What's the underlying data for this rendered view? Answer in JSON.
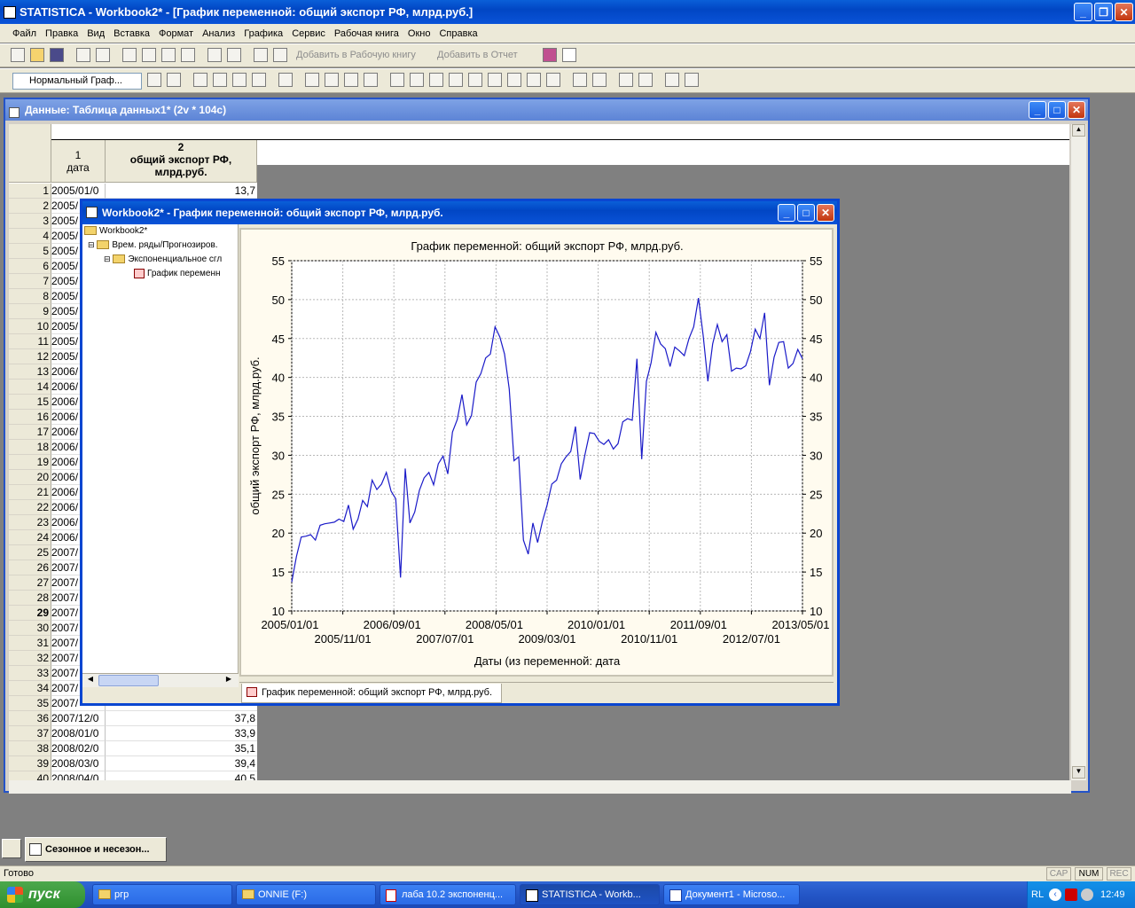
{
  "app": {
    "title": "STATISTICA - Workbook2* - [График переменной: общий экспорт РФ, млрд.руб.]",
    "menu": [
      "Файл",
      "Правка",
      "Вид",
      "Вставка",
      "Формат",
      "Анализ",
      "Графика",
      "Сервис",
      "Рабочая книга",
      "Окно",
      "Справка"
    ]
  },
  "toolbar1": {
    "add_to_workbook": "Добавить в Рабочую книгу",
    "add_to_report": "Добавить в Отчет"
  },
  "toolbar2": {
    "style_select": "Нормальный Граф..."
  },
  "data_window": {
    "title": "Данные: Таблица данных1* (2v * 104c)",
    "col1_num": "1",
    "col1_name": "дата",
    "col2_num": "2",
    "col2_name": "общий экспорт РФ, млрд.руб.",
    "rows": [
      {
        "n": "1",
        "date": "2005/01/0",
        "value": "13,7"
      },
      {
        "n": "2",
        "date": "2005/",
        "value": ""
      },
      {
        "n": "3",
        "date": "2005/",
        "value": ""
      },
      {
        "n": "4",
        "date": "2005/",
        "value": ""
      },
      {
        "n": "5",
        "date": "2005/",
        "value": ""
      },
      {
        "n": "6",
        "date": "2005/",
        "value": ""
      },
      {
        "n": "7",
        "date": "2005/",
        "value": ""
      },
      {
        "n": "8",
        "date": "2005/",
        "value": ""
      },
      {
        "n": "9",
        "date": "2005/",
        "value": ""
      },
      {
        "n": "10",
        "date": "2005/",
        "value": ""
      },
      {
        "n": "11",
        "date": "2005/",
        "value": ""
      },
      {
        "n": "12",
        "date": "2005/",
        "value": ""
      },
      {
        "n": "13",
        "date": "2006/",
        "value": ""
      },
      {
        "n": "14",
        "date": "2006/",
        "value": ""
      },
      {
        "n": "15",
        "date": "2006/",
        "value": ""
      },
      {
        "n": "16",
        "date": "2006/",
        "value": ""
      },
      {
        "n": "17",
        "date": "2006/",
        "value": ""
      },
      {
        "n": "18",
        "date": "2006/",
        "value": ""
      },
      {
        "n": "19",
        "date": "2006/",
        "value": ""
      },
      {
        "n": "20",
        "date": "2006/",
        "value": ""
      },
      {
        "n": "21",
        "date": "2006/",
        "value": ""
      },
      {
        "n": "22",
        "date": "2006/",
        "value": ""
      },
      {
        "n": "23",
        "date": "2006/",
        "value": ""
      },
      {
        "n": "24",
        "date": "2006/",
        "value": ""
      },
      {
        "n": "25",
        "date": "2007/",
        "value": ""
      },
      {
        "n": "26",
        "date": "2007/",
        "value": ""
      },
      {
        "n": "27",
        "date": "2007/",
        "value": ""
      },
      {
        "n": "28",
        "date": "2007/",
        "value": ""
      },
      {
        "n": "29",
        "date": "2007/",
        "value": ""
      },
      {
        "n": "30",
        "date": "2007/",
        "value": ""
      },
      {
        "n": "31",
        "date": "2007/",
        "value": ""
      },
      {
        "n": "32",
        "date": "2007/",
        "value": ""
      },
      {
        "n": "33",
        "date": "2007/",
        "value": ""
      },
      {
        "n": "34",
        "date": "2007/",
        "value": ""
      },
      {
        "n": "35",
        "date": "2007/",
        "value": ""
      },
      {
        "n": "36",
        "date": "2007/12/0",
        "value": "37,8"
      },
      {
        "n": "37",
        "date": "2008/01/0",
        "value": "33,9"
      },
      {
        "n": "38",
        "date": "2008/02/0",
        "value": "35,1"
      },
      {
        "n": "39",
        "date": "2008/03/0",
        "value": "39,4"
      },
      {
        "n": "40",
        "date": "2008/04/0",
        "value": "40,5"
      }
    ]
  },
  "graph_window": {
    "title": "Workbook2* - График переменной: общий экспорт РФ, млрд.руб.",
    "tree": {
      "root": "Workbook2*",
      "level1": "Врем. ряды/Прогнозиров.",
      "level2": "Экспоненциальное сгл",
      "level3": "График переменн"
    },
    "tab_label": "График переменной: общий экспорт РФ, млрд.руб."
  },
  "chart_data": {
    "type": "line",
    "title": "График переменной: общий экспорт РФ, млрд.руб.",
    "xlabel": "Даты (из переменной: дата",
    "ylabel": "общий экспорт РФ, млрд.руб.",
    "ylim": [
      10,
      55
    ],
    "yticks": [
      10,
      15,
      20,
      25,
      30,
      35,
      40,
      45,
      50,
      55
    ],
    "xticks_row1": [
      "2005/01/01",
      "2006/09/01",
      "2008/05/01",
      "2010/01/01",
      "2011/09/01",
      "2013/05/01"
    ],
    "xticks_row2": [
      "2005/11/01",
      "2007/07/01",
      "2009/03/01",
      "2010/11/01",
      "2012/07/01"
    ],
    "grid": true,
    "series": [
      {
        "color": "#1a1ac8",
        "values": [
          13.7,
          17.0,
          19.5,
          19.6,
          19.8,
          19.1,
          21.0,
          21.2,
          21.3,
          21.4,
          21.8,
          21.5,
          23.6,
          20.5,
          21.8,
          24.2,
          23.4,
          26.8,
          25.6,
          26.3,
          27.8,
          25.4,
          24.4,
          14.3,
          28.3,
          21.3,
          22.7,
          25.5,
          27.1,
          27.8,
          26.2,
          28.9,
          29.9,
          27.6,
          33.0,
          34.6,
          37.8,
          33.9,
          35.1,
          39.4,
          40.5,
          42.5,
          43.0,
          46.5,
          45.2,
          43.0,
          38.5,
          29.3,
          29.8,
          19.1,
          17.3,
          21.3,
          18.8,
          21.5,
          23.6,
          26.3,
          26.8,
          28.9,
          29.8,
          30.5,
          33.7,
          26.9,
          30.1,
          32.9,
          32.8,
          31.8,
          31.4,
          32.0,
          30.8,
          31.5,
          34.3,
          34.7,
          34.5,
          42.4,
          29.5,
          39.5,
          41.9,
          45.8,
          44.3,
          43.7,
          41.4,
          43.9,
          43.4,
          42.8,
          45.0,
          46.5,
          50.2,
          45.4,
          39.5,
          44.3,
          46.8,
          44.6,
          45.5,
          40.8,
          41.2,
          41.1,
          41.5,
          43.3,
          46.2,
          45.0,
          48.3,
          39.0,
          42.6,
          44.5,
          44.6,
          41.2,
          41.8,
          43.6,
          42.4
        ]
      }
    ]
  },
  "status": {
    "left": "Готово",
    "cap": "CAP",
    "num": "NUM",
    "rec": "REC"
  },
  "minimized_window": "Сезонное и несезон...",
  "taskbar": {
    "start": "пуск",
    "tasks": [
      "ргр",
      "ONNIE (F:)",
      "лаба 10.2 экспоненц...",
      "STATISTICA - Workb...",
      "Документ1 - Microso..."
    ],
    "lang": "RL",
    "clock": "12:49"
  }
}
